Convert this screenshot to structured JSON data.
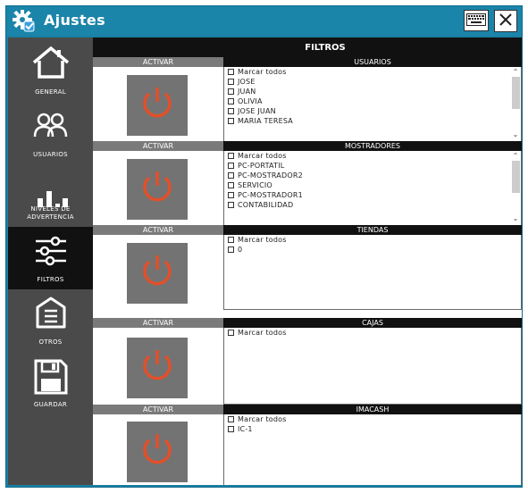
{
  "window": {
    "title": "Ajustes"
  },
  "icons": {
    "title": "settings-gear-icon",
    "keyboard": "keyboard-icon",
    "close": "close-icon",
    "power": "power-icon"
  },
  "colors": {
    "titlebar": "#1b84a9",
    "sidebar": "#4a4a4a",
    "active_nav": "#111111",
    "power_button_bg": "#737373",
    "power_symbol": "#e2502a"
  },
  "sidebar": {
    "items": [
      {
        "label": "GENERAL",
        "icon": "home-icon",
        "active": false
      },
      {
        "label": "USUARIOS",
        "icon": "users-icon",
        "active": false
      },
      {
        "label": "NIVELES DE\nADVERTENCIA",
        "icon": "bar-chart-icon",
        "active": false
      },
      {
        "label": "FILTROS",
        "icon": "sliders-icon",
        "active": true
      },
      {
        "label": "OTROS",
        "icon": "document-icon",
        "active": false
      },
      {
        "label": "GUARDAR",
        "icon": "save-icon",
        "active": false
      }
    ]
  },
  "main": {
    "header": "FILTROS",
    "activar_label": "ACTIVAR",
    "sections": [
      {
        "title": "USUARIOS",
        "items": [
          "Marcar todos",
          "JOSE",
          "JUAN",
          "OLIVIA",
          "JOSE JUAN",
          "MARIA TERESA"
        ],
        "scrollbar": true
      },
      {
        "title": "MOSTRADORES",
        "items": [
          "Marcar todos",
          "PC-PORTATIL",
          "PC-MOSTRADOR2",
          "SERVICIO",
          "PC-MOSTRADOR1",
          "CONTABILIDAD"
        ],
        "scrollbar": true
      },
      {
        "title": "TIENDAS",
        "items": [
          "Marcar todos",
          "0"
        ],
        "scrollbar": false
      },
      {
        "title": "CAJAS",
        "items": [
          "Marcar todos"
        ],
        "scrollbar": false
      },
      {
        "title": "IMACASH",
        "items": [
          "Marcar todos",
          "IC-1"
        ],
        "scrollbar": false
      }
    ]
  }
}
